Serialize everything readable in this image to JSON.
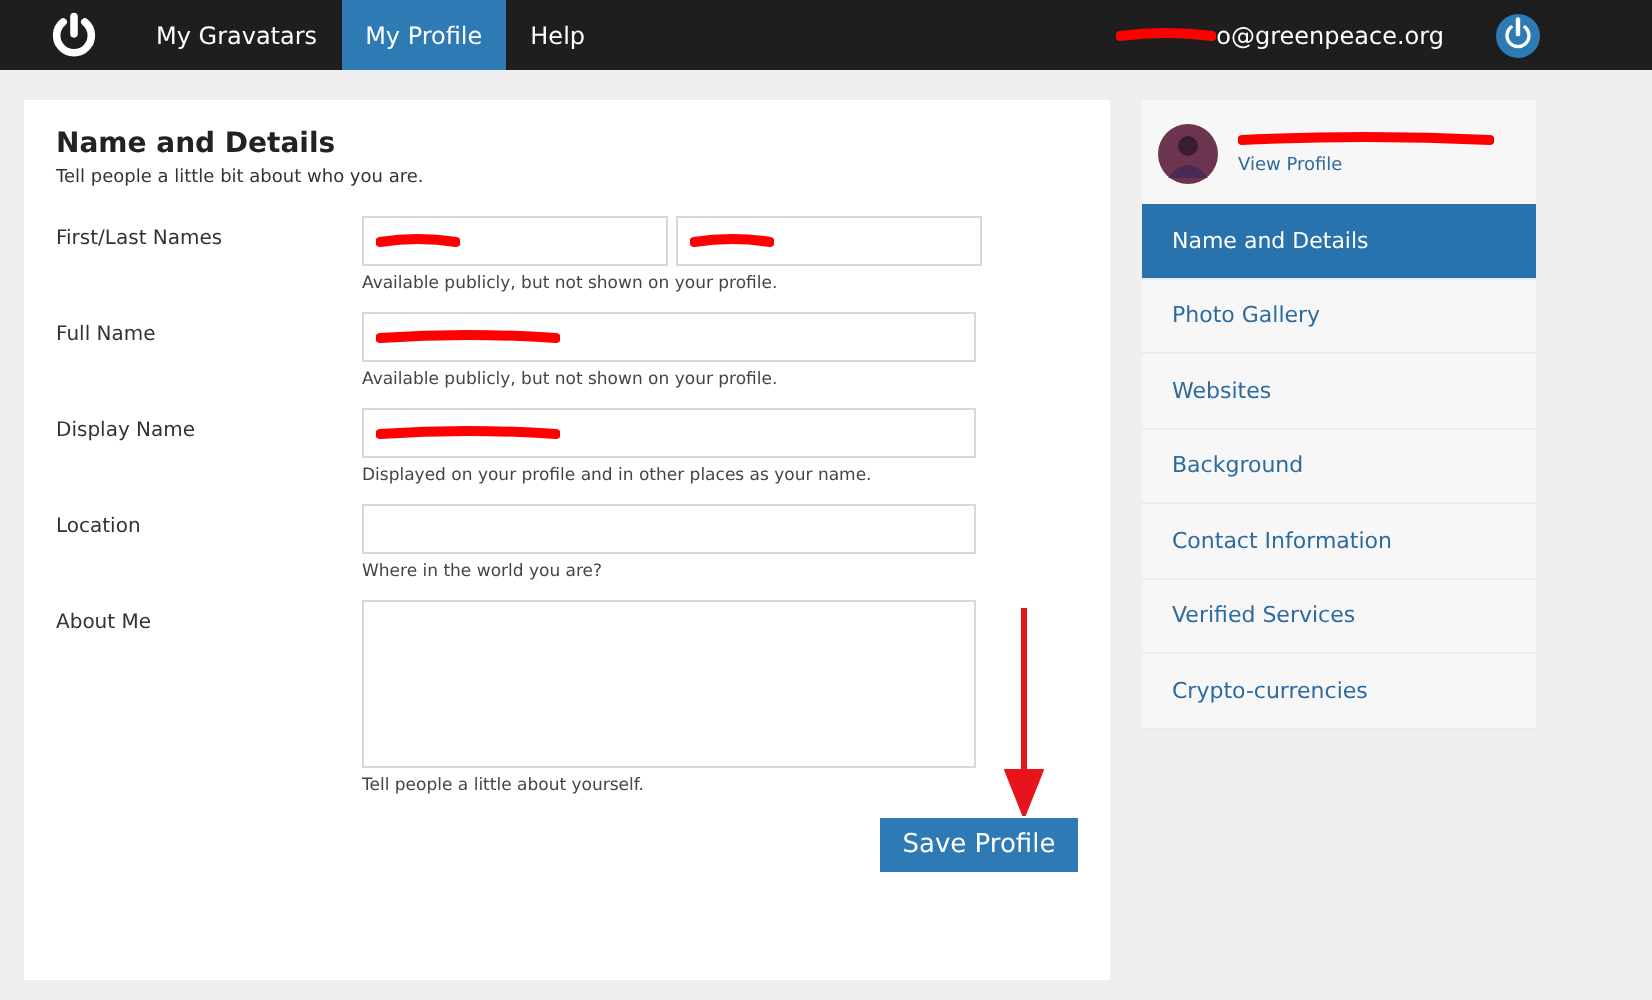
{
  "nav": {
    "items": [
      {
        "label": "My Gravatars",
        "selected": false
      },
      {
        "label": "My Profile",
        "selected": true
      },
      {
        "label": "Help",
        "selected": false
      }
    ],
    "email": "o@greenpeace.org",
    "email_redacted": true
  },
  "form": {
    "title": "Name and Details",
    "subtitle": "Tell people a little bit about who you are.",
    "rows": [
      {
        "label": "First/Last Names",
        "kind": "pair",
        "fields": [
          {
            "redacted": true
          },
          {
            "redacted": true
          }
        ],
        "hint": "Available publicly, but not shown on your profile."
      },
      {
        "label": "Full Name",
        "kind": "single",
        "fields": [
          {
            "redacted": true
          }
        ],
        "hint": "Available publicly, but not shown on your profile."
      },
      {
        "label": "Display Name",
        "kind": "single",
        "fields": [
          {
            "redacted": true
          }
        ],
        "hint": "Displayed on your profile and in other places as your name."
      },
      {
        "label": "Location",
        "kind": "single",
        "fields": [
          {
            "redacted": false
          }
        ],
        "hint": "Where in the world you are?"
      },
      {
        "label": "About Me",
        "kind": "textarea",
        "fields": [
          {
            "redacted": false
          }
        ],
        "hint": "Tell people a little about yourself."
      }
    ],
    "button": "Save Profile",
    "arrow": true
  },
  "sidebar": {
    "name_redacted": true,
    "view_profile": "View Profile",
    "items": [
      {
        "label": "Name and Details",
        "selected": true
      },
      {
        "label": "Photo Gallery",
        "selected": false
      },
      {
        "label": "Websites",
        "selected": false
      },
      {
        "label": "Background",
        "selected": false
      },
      {
        "label": "Contact Information",
        "selected": false
      },
      {
        "label": "Verified Services",
        "selected": false
      },
      {
        "label": "Crypto-currencies",
        "selected": false
      }
    ]
  }
}
